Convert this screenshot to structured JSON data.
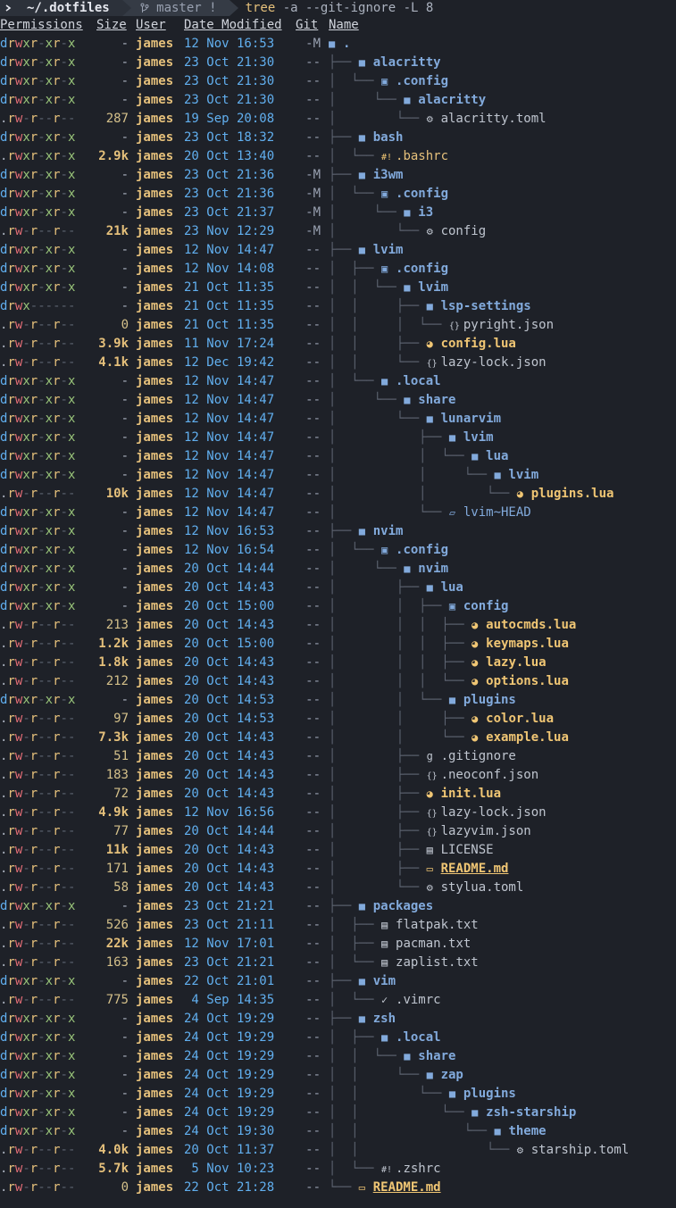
{
  "prompt": {
    "os_icon": "terminal-icon",
    "directory": "~/.dotfiles",
    "git_branch": " master !",
    "command_name": "tree",
    "command_args": " -a --git-ignore -L 8"
  },
  "headers": {
    "permissions": "Permissions",
    "size": "Size",
    "user": "User",
    "date": "Date Modified",
    "git": "Git",
    "name": "Name"
  },
  "colors": {
    "background": "#1e2128",
    "directory": "#82aadc",
    "user": "#e5c07b",
    "date": "#61afef"
  },
  "rows": [
    {
      "perm": "drwxr-xr-x",
      "size": "-",
      "user": "james",
      "date": "12 Nov 16:53",
      "git": "-M",
      "prefix": "",
      "icon": "folder-icon",
      "name": ".",
      "kind": "dir"
    },
    {
      "perm": "drwxr-xr-x",
      "size": "-",
      "user": "james",
      "date": "23 Oct 21:30",
      "git": "--",
      "prefix": "├── ",
      "icon": "folder-icon",
      "name": "alacritty",
      "kind": "dir"
    },
    {
      "perm": "drwxr-xr-x",
      "size": "-",
      "user": "james",
      "date": "23 Oct 21:30",
      "git": "--",
      "prefix": "│  └── ",
      "icon": "folder-config-icon",
      "name": ".config",
      "kind": "dir"
    },
    {
      "perm": "drwxr-xr-x",
      "size": "-",
      "user": "james",
      "date": "23 Oct 21:30",
      "git": "--",
      "prefix": "│     └── ",
      "icon": "folder-icon",
      "name": "alacritty",
      "kind": "dir"
    },
    {
      "perm": ".rw-r--r--",
      "size": "287",
      "user": "james",
      "date": "19 Sep 20:08",
      "git": "--",
      "prefix": "│        └── ",
      "icon": "gear-icon",
      "name": "alacritty.toml",
      "kind": "file"
    },
    {
      "perm": "drwxr-xr-x",
      "size": "-",
      "user": "james",
      "date": "23 Oct 18:32",
      "git": "--",
      "prefix": "├── ",
      "icon": "folder-icon",
      "name": "bash",
      "kind": "dir"
    },
    {
      "perm": ".rwxr-xr-x",
      "size": "2.9k",
      "user": "james",
      "date": "20 Oct 13:40",
      "git": "--",
      "prefix": "│  └── ",
      "icon": "shell-icon",
      "name": ".bashrc",
      "kind": "sh"
    },
    {
      "perm": "drwxr-xr-x",
      "size": "-",
      "user": "james",
      "date": "23 Oct 21:36",
      "git": "-M",
      "prefix": "├── ",
      "icon": "folder-icon",
      "name": "i3wm",
      "kind": "dir"
    },
    {
      "perm": "drwxr-xr-x",
      "size": "-",
      "user": "james",
      "date": "23 Oct 21:36",
      "git": "-M",
      "prefix": "│  └── ",
      "icon": "folder-config-icon",
      "name": ".config",
      "kind": "dir"
    },
    {
      "perm": "drwxr-xr-x",
      "size": "-",
      "user": "james",
      "date": "23 Oct 21:37",
      "git": "-M",
      "prefix": "│     └── ",
      "icon": "folder-icon",
      "name": "i3",
      "kind": "dir"
    },
    {
      "perm": ".rw-r--r--",
      "size": "21k",
      "user": "james",
      "date": "23 Nov 12:29",
      "git": "-M",
      "prefix": "│        └── ",
      "icon": "gear-icon",
      "name": "config",
      "kind": "file"
    },
    {
      "perm": "drwxr-xr-x",
      "size": "-",
      "user": "james",
      "date": "12 Nov 14:47",
      "git": "--",
      "prefix": "├── ",
      "icon": "folder-icon",
      "name": "lvim",
      "kind": "dir"
    },
    {
      "perm": "drwxr-xr-x",
      "size": "-",
      "user": "james",
      "date": "12 Nov 14:08",
      "git": "--",
      "prefix": "│  ├── ",
      "icon": "folder-config-icon",
      "name": ".config",
      "kind": "dir"
    },
    {
      "perm": "drwxr-xr-x",
      "size": "-",
      "user": "james",
      "date": "21 Oct 11:35",
      "git": "--",
      "prefix": "│  │  └── ",
      "icon": "folder-icon",
      "name": "lvim",
      "kind": "dir"
    },
    {
      "perm": "drwx------",
      "size": "-",
      "user": "james",
      "date": "21 Oct 11:35",
      "git": "--",
      "prefix": "│  │     ├── ",
      "icon": "folder-icon",
      "name": "lsp-settings",
      "kind": "dir"
    },
    {
      "perm": ".rw-r--r--",
      "size": "0",
      "user": "james",
      "date": "21 Oct 11:35",
      "git": "--",
      "prefix": "│  │     │  └── ",
      "icon": "json-icon",
      "name": "pyright.json",
      "kind": "file"
    },
    {
      "perm": ".rw-r--r--",
      "size": "3.9k",
      "user": "james",
      "date": "11 Nov 17:24",
      "git": "--",
      "prefix": "│  │     ├── ",
      "icon": "lua-icon",
      "name": "config.lua",
      "kind": "lua"
    },
    {
      "perm": ".rw-r--r--",
      "size": "4.1k",
      "user": "james",
      "date": "12 Dec 19:42",
      "git": "--",
      "prefix": "│  │     └── ",
      "icon": "json-icon",
      "name": "lazy-lock.json",
      "kind": "file"
    },
    {
      "perm": "drwxr-xr-x",
      "size": "-",
      "user": "james",
      "date": "12 Nov 14:47",
      "git": "--",
      "prefix": "│  └── ",
      "icon": "folder-icon",
      "name": ".local",
      "kind": "dir"
    },
    {
      "perm": "drwxr-xr-x",
      "size": "-",
      "user": "james",
      "date": "12 Nov 14:47",
      "git": "--",
      "prefix": "│     └── ",
      "icon": "folder-icon",
      "name": "share",
      "kind": "dir"
    },
    {
      "perm": "drwxr-xr-x",
      "size": "-",
      "user": "james",
      "date": "12 Nov 14:47",
      "git": "--",
      "prefix": "│        └── ",
      "icon": "folder-icon",
      "name": "lunarvim",
      "kind": "dir"
    },
    {
      "perm": "drwxr-xr-x",
      "size": "-",
      "user": "james",
      "date": "12 Nov 14:47",
      "git": "--",
      "prefix": "│           ├── ",
      "icon": "folder-icon",
      "name": "lvim",
      "kind": "dir"
    },
    {
      "perm": "drwxr-xr-x",
      "size": "-",
      "user": "james",
      "date": "12 Nov 14:47",
      "git": "--",
      "prefix": "│           │  └── ",
      "icon": "folder-icon",
      "name": "lua",
      "kind": "dir"
    },
    {
      "perm": "drwxr-xr-x",
      "size": "-",
      "user": "james",
      "date": "12 Nov 14:47",
      "git": "--",
      "prefix": "│           │     └── ",
      "icon": "folder-icon",
      "name": "lvim",
      "kind": "dir"
    },
    {
      "perm": ".rw-r--r--",
      "size": "10k",
      "user": "james",
      "date": "12 Nov 14:47",
      "git": "--",
      "prefix": "│           │        └── ",
      "icon": "lua-icon",
      "name": "plugins.lua",
      "kind": "lua"
    },
    {
      "perm": "drwxr-xr-x",
      "size": "-",
      "user": "james",
      "date": "12 Nov 14:47",
      "git": "--",
      "prefix": "│           └── ",
      "icon": "folder-open-icon",
      "name": "lvim~HEAD",
      "kind": "head"
    },
    {
      "perm": "drwxr-xr-x",
      "size": "-",
      "user": "james",
      "date": "12 Nov 16:53",
      "git": "--",
      "prefix": "├── ",
      "icon": "folder-icon",
      "name": "nvim",
      "kind": "dir"
    },
    {
      "perm": "drwxr-xr-x",
      "size": "-",
      "user": "james",
      "date": "12 Nov 16:54",
      "git": "--",
      "prefix": "│  └── ",
      "icon": "folder-config-icon",
      "name": ".config",
      "kind": "dir"
    },
    {
      "perm": "drwxr-xr-x",
      "size": "-",
      "user": "james",
      "date": "20 Oct 14:44",
      "git": "--",
      "prefix": "│     └── ",
      "icon": "folder-icon",
      "name": "nvim",
      "kind": "dir"
    },
    {
      "perm": "drwxr-xr-x",
      "size": "-",
      "user": "james",
      "date": "20 Oct 14:43",
      "git": "--",
      "prefix": "│        ├── ",
      "icon": "folder-icon",
      "name": "lua",
      "kind": "dir"
    },
    {
      "perm": "drwxr-xr-x",
      "size": "-",
      "user": "james",
      "date": "20 Oct 15:00",
      "git": "--",
      "prefix": "│        │  ├── ",
      "icon": "folder-config-icon",
      "name": "config",
      "kind": "dir"
    },
    {
      "perm": ".rw-r--r--",
      "size": "213",
      "user": "james",
      "date": "20 Oct 14:43",
      "git": "--",
      "prefix": "│        │  │  ├── ",
      "icon": "lua-icon",
      "name": "autocmds.lua",
      "kind": "lua"
    },
    {
      "perm": ".rw-r--r--",
      "size": "1.2k",
      "user": "james",
      "date": "20 Oct 15:00",
      "git": "--",
      "prefix": "│        │  │  ├── ",
      "icon": "lua-icon",
      "name": "keymaps.lua",
      "kind": "lua"
    },
    {
      "perm": ".rw-r--r--",
      "size": "1.8k",
      "user": "james",
      "date": "20 Oct 14:43",
      "git": "--",
      "prefix": "│        │  │  ├── ",
      "icon": "lua-icon",
      "name": "lazy.lua",
      "kind": "lua"
    },
    {
      "perm": ".rw-r--r--",
      "size": "212",
      "user": "james",
      "date": "20 Oct 14:43",
      "git": "--",
      "prefix": "│        │  │  └── ",
      "icon": "lua-icon",
      "name": "options.lua",
      "kind": "lua"
    },
    {
      "perm": "drwxr-xr-x",
      "size": "-",
      "user": "james",
      "date": "20 Oct 14:53",
      "git": "--",
      "prefix": "│        │  └── ",
      "icon": "folder-icon",
      "name": "plugins",
      "kind": "dir"
    },
    {
      "perm": ".rw-r--r--",
      "size": "97",
      "user": "james",
      "date": "20 Oct 14:53",
      "git": "--",
      "prefix": "│        │     ├── ",
      "icon": "lua-icon",
      "name": "color.lua",
      "kind": "lua"
    },
    {
      "perm": ".rw-r--r--",
      "size": "7.3k",
      "user": "james",
      "date": "20 Oct 14:43",
      "git": "--",
      "prefix": "│        │     └── ",
      "icon": "lua-icon",
      "name": "example.lua",
      "kind": "lua"
    },
    {
      "perm": ".rw-r--r--",
      "size": "51",
      "user": "james",
      "date": "20 Oct 14:43",
      "git": "--",
      "prefix": "│        ├── ",
      "icon": "git-icon",
      "name": ".gitignore",
      "kind": "file"
    },
    {
      "perm": ".rw-r--r--",
      "size": "183",
      "user": "james",
      "date": "20 Oct 14:43",
      "git": "--",
      "prefix": "│        ├── ",
      "icon": "json-icon",
      "name": ".neoconf.json",
      "kind": "file"
    },
    {
      "perm": ".rw-r--r--",
      "size": "72",
      "user": "james",
      "date": "20 Oct 14:43",
      "git": "--",
      "prefix": "│        ├── ",
      "icon": "lua-icon",
      "name": "init.lua",
      "kind": "lua"
    },
    {
      "perm": ".rw-r--r--",
      "size": "4.9k",
      "user": "james",
      "date": "12 Nov 16:56",
      "git": "--",
      "prefix": "│        ├── ",
      "icon": "json-icon",
      "name": "lazy-lock.json",
      "kind": "file"
    },
    {
      "perm": ".rw-r--r--",
      "size": "77",
      "user": "james",
      "date": "20 Oct 14:44",
      "git": "--",
      "prefix": "│        ├── ",
      "icon": "json-icon",
      "name": "lazyvim.json",
      "kind": "file"
    },
    {
      "perm": ".rw-r--r--",
      "size": "11k",
      "user": "james",
      "date": "20 Oct 14:43",
      "git": "--",
      "prefix": "│        ├── ",
      "icon": "license-icon",
      "name": "LICENSE",
      "kind": "file"
    },
    {
      "perm": ".rw-r--r--",
      "size": "171",
      "user": "james",
      "date": "20 Oct 14:43",
      "git": "--",
      "prefix": "│        ├── ",
      "icon": "markdown-icon",
      "name": "README.md",
      "kind": "md"
    },
    {
      "perm": ".rw-r--r--",
      "size": "58",
      "user": "james",
      "date": "20 Oct 14:43",
      "git": "--",
      "prefix": "│        └── ",
      "icon": "gear-icon",
      "name": "stylua.toml",
      "kind": "file"
    },
    {
      "perm": "drwxr-xr-x",
      "size": "-",
      "user": "james",
      "date": "23 Oct 21:21",
      "git": "--",
      "prefix": "├── ",
      "icon": "folder-icon",
      "name": "packages",
      "kind": "dir"
    },
    {
      "perm": ".rw-r--r--",
      "size": "526",
      "user": "james",
      "date": "23 Oct 21:11",
      "git": "--",
      "prefix": "│  ├── ",
      "icon": "text-file-icon",
      "name": "flatpak.txt",
      "kind": "file"
    },
    {
      "perm": ".rw-r--r--",
      "size": "22k",
      "user": "james",
      "date": "12 Nov 17:01",
      "git": "--",
      "prefix": "│  ├── ",
      "icon": "text-file-icon",
      "name": "pacman.txt",
      "kind": "file"
    },
    {
      "perm": ".rw-r--r--",
      "size": "163",
      "user": "james",
      "date": "23 Oct 21:21",
      "git": "--",
      "prefix": "│  └── ",
      "icon": "text-file-icon",
      "name": "zaplist.txt",
      "kind": "file"
    },
    {
      "perm": "drwxr-xr-x",
      "size": "-",
      "user": "james",
      "date": "22 Oct 21:01",
      "git": "--",
      "prefix": "├── ",
      "icon": "folder-icon",
      "name": "vim",
      "kind": "dir"
    },
    {
      "perm": ".rw-r--r--",
      "size": "775",
      "user": "james",
      "date": " 4 Sep 14:35",
      "git": "--",
      "prefix": "│  └── ",
      "icon": "vim-icon",
      "name": ".vimrc",
      "kind": "file"
    },
    {
      "perm": "drwxr-xr-x",
      "size": "-",
      "user": "james",
      "date": "24 Oct 19:29",
      "git": "--",
      "prefix": "├── ",
      "icon": "folder-icon",
      "name": "zsh",
      "kind": "dir"
    },
    {
      "perm": "drwxr-xr-x",
      "size": "-",
      "user": "james",
      "date": "24 Oct 19:29",
      "git": "--",
      "prefix": "│  ├── ",
      "icon": "folder-icon",
      "name": ".local",
      "kind": "dir"
    },
    {
      "perm": "drwxr-xr-x",
      "size": "-",
      "user": "james",
      "date": "24 Oct 19:29",
      "git": "--",
      "prefix": "│  │  └── ",
      "icon": "folder-icon",
      "name": "share",
      "kind": "dir"
    },
    {
      "perm": "drwxr-xr-x",
      "size": "-",
      "user": "james",
      "date": "24 Oct 19:29",
      "git": "--",
      "prefix": "│  │     └── ",
      "icon": "folder-icon",
      "name": "zap",
      "kind": "dir"
    },
    {
      "perm": "drwxr-xr-x",
      "size": "-",
      "user": "james",
      "date": "24 Oct 19:29",
      "git": "--",
      "prefix": "│  │        └── ",
      "icon": "folder-icon",
      "name": "plugins",
      "kind": "dir"
    },
    {
      "perm": "drwxr-xr-x",
      "size": "-",
      "user": "james",
      "date": "24 Oct 19:29",
      "git": "--",
      "prefix": "│  │           └── ",
      "icon": "folder-icon",
      "name": "zsh-starship",
      "kind": "dir"
    },
    {
      "perm": "drwxr-xr-x",
      "size": "-",
      "user": "james",
      "date": "24 Oct 19:30",
      "git": "--",
      "prefix": "│  │              └── ",
      "icon": "folder-icon",
      "name": "theme",
      "kind": "dir"
    },
    {
      "perm": ".rw-r--r--",
      "size": "4.0k",
      "user": "james",
      "date": "20 Oct 11:37",
      "git": "--",
      "prefix": "│  │                 └── ",
      "icon": "gear-icon",
      "name": "starship.toml",
      "kind": "file"
    },
    {
      "perm": ".rw-r--r--",
      "size": "5.7k",
      "user": "james",
      "date": " 5 Nov 10:23",
      "git": "--",
      "prefix": "│  └── ",
      "icon": "shell-icon",
      "name": ".zshrc",
      "kind": "file"
    },
    {
      "perm": ".rw-r--r--",
      "size": "0",
      "user": "james",
      "date": "22 Oct 21:28",
      "git": "--",
      "prefix": "└── ",
      "icon": "markdown-icon",
      "name": "README.md",
      "kind": "md"
    }
  ]
}
